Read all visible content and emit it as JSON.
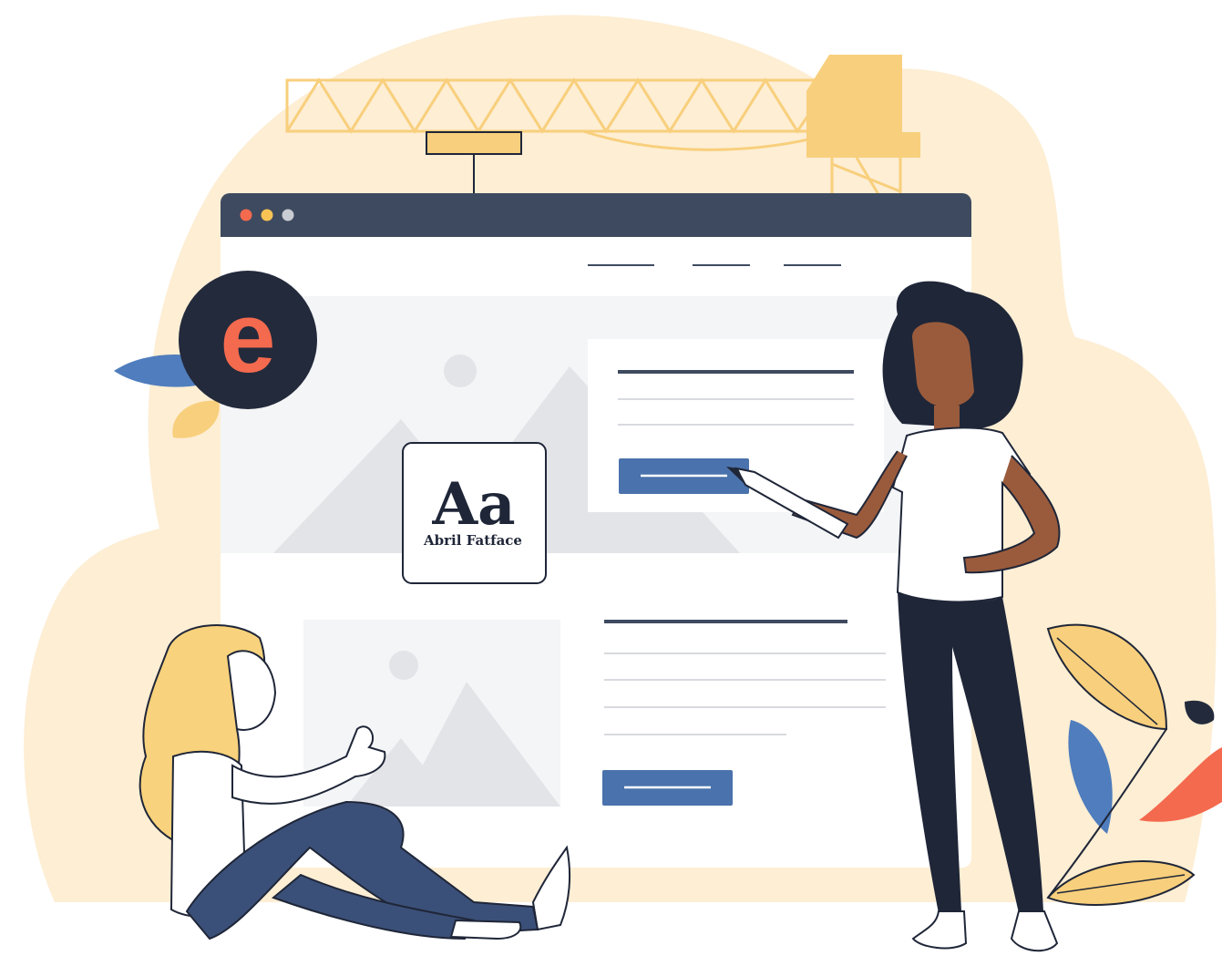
{
  "font_card": {
    "sample": "Aa",
    "font_name": "Abril Fatface"
  },
  "logo": {
    "letter": "e",
    "icon": "elementor-e-logo"
  },
  "window": {
    "controls": [
      "close-dot",
      "minimize-dot",
      "maximize-dot"
    ]
  },
  "colors": {
    "backdrop": "#fdeed4",
    "crane": "#f8cf7c",
    "titlebar": "#3e4a5f",
    "browser_body": "#ffffff",
    "hero_panel": "#f4f5f7",
    "placeholder_gray": "#e3e4e8",
    "button_blue": "#4a72ac",
    "text_line": "#3e4a5f",
    "light_line": "#d8dadf",
    "dot_red": "#f46a4e",
    "dot_yellow": "#f8c355",
    "dot_gray": "#c9ccd2",
    "logo_dark": "#232a3c",
    "logo_orange": "#f46a4e",
    "leaf_blue": "#4f7dbd",
    "leaf_yellow": "#f8cf7c",
    "skin_dark": "#9a5b3c",
    "hair_dark": "#1f2638",
    "hair_blonde": "#f8d27c",
    "pants_navy": "#1f2638",
    "pants_blue": "#3b5078",
    "outline": "#1f2638"
  }
}
